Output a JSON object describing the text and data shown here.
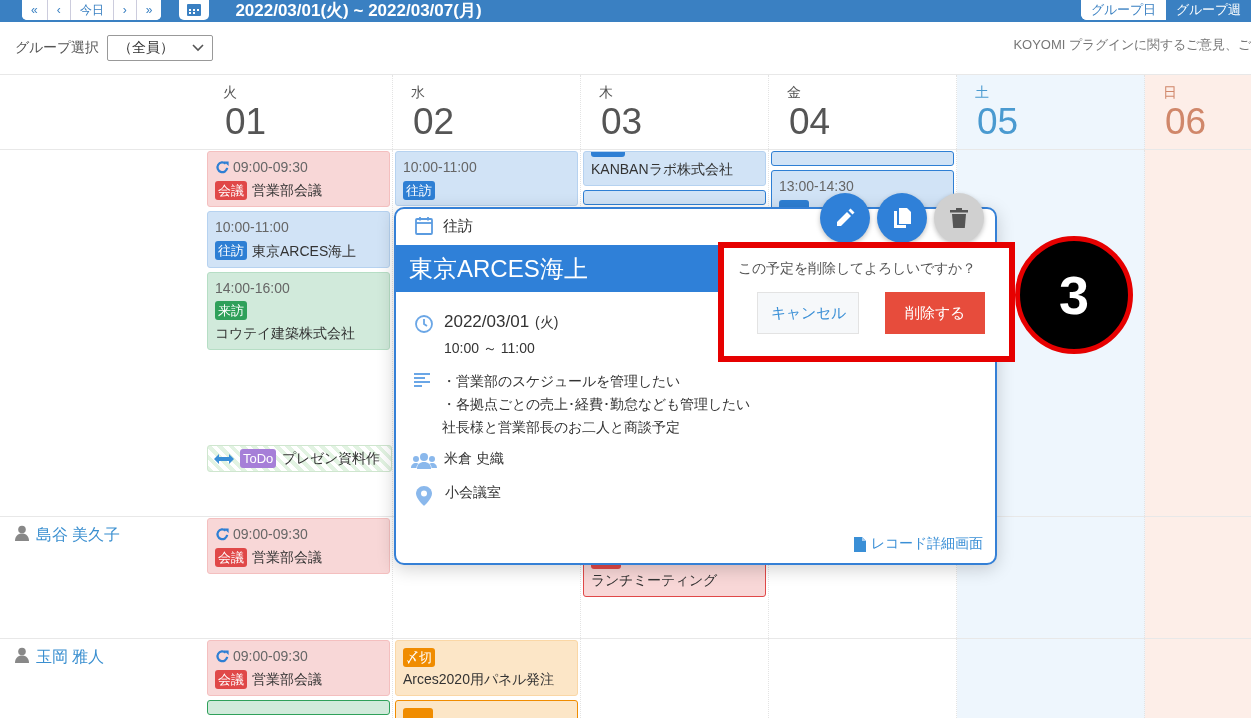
{
  "header": {
    "nav_buttons": [
      "«",
      "‹",
      "今日",
      "›",
      "»"
    ],
    "title": "2022/03/01(火) ~ 2022/03/07(月)",
    "view_buttons": [
      {
        "label": "グループ日",
        "selected": false
      },
      {
        "label": "グループ週",
        "selected": true
      }
    ]
  },
  "toolbar": {
    "group_label": "グループ選択",
    "group_select": "（全員）",
    "notice": "KOYOMI プラグインに関するご意見、ご"
  },
  "days": [
    {
      "weekday": "火",
      "date": "01",
      "kind": "weekday"
    },
    {
      "weekday": "水",
      "date": "02",
      "kind": "weekday"
    },
    {
      "weekday": "木",
      "date": "03",
      "kind": "weekday"
    },
    {
      "weekday": "金",
      "date": "04",
      "kind": "weekday"
    },
    {
      "weekday": "土",
      "date": "05",
      "kind": "saturday"
    },
    {
      "weekday": "日",
      "date": "06",
      "kind": "sunday"
    }
  ],
  "rows": [
    {
      "cells": [
        [
          {
            "kind": "timed",
            "repeat": true,
            "time": "09:00-09:30",
            "tag": "会議",
            "title": "営業部会議",
            "color": "#e04848"
          },
          {
            "kind": "timed",
            "repeat": false,
            "time": "10:00-11:00",
            "tag": "往訪",
            "title": "東京ARCES海上",
            "color": "#2e7fd4"
          },
          {
            "kind": "timed",
            "repeat": false,
            "time": "14:00-16:00",
            "tag": "来訪",
            "title": "コウテイ建築株式会社",
            "color": "#2fa05a"
          },
          {
            "kind": "todo",
            "tag": "ToDo",
            "title": "プレゼン資料作",
            "color": "#a67fd8"
          }
        ],
        [
          {
            "kind": "timed",
            "repeat": false,
            "time": "10:00-11:00",
            "tag": "往訪",
            "color": "#2e7fd4"
          }
        ],
        [
          {
            "kind": "clipped",
            "title": "KANBANラボ株式会社",
            "color": "#2e7fd4"
          },
          {
            "kind": "fragment",
            "color": "#2e7fd4"
          }
        ],
        [
          {
            "kind": "fragment",
            "color": "#2e7fd4"
          },
          {
            "kind": "timed",
            "repeat": false,
            "time": "13:00-14:30",
            "color": "#2e7fd4"
          }
        ],
        [],
        []
      ]
    },
    {
      "user": "島谷 美久子",
      "cells": [
        [
          {
            "kind": "timed",
            "repeat": true,
            "time": "09:00-09:30",
            "tag": "会議",
            "title": "営業部会議",
            "color": "#e04848"
          }
        ],
        [],
        [
          {
            "kind": "tail",
            "title": "ランチミーティング",
            "color": "#e04848"
          }
        ],
        [],
        [],
        []
      ]
    },
    {
      "user": "玉岡 雅人",
      "cells": [
        [
          {
            "kind": "timed",
            "repeat": true,
            "time": "09:00-09:30",
            "tag": "会議",
            "title": "営業部会議",
            "color": "#e04848"
          },
          {
            "kind": "fragment",
            "color": "#2fa05a"
          }
        ],
        [
          {
            "kind": "deadline",
            "tag": "〆切",
            "title": "Arces2020用パネル発注",
            "color": "#f08c00"
          },
          {
            "kind": "deadline",
            "color": "#f08c00"
          }
        ],
        [],
        [],
        [],
        []
      ]
    }
  ],
  "popup": {
    "category": "往訪",
    "title": "東京ARCES海上",
    "date": "2022/03/01",
    "weekday": "(火)",
    "time": "10:00 ～ 11:00",
    "description": [
      "・営業部のスケジュールを管理したい",
      "・各拠点ごとの売上･経費･勤怠なども管理したい",
      "社長様と営業部長のお二人と商談予定"
    ],
    "attendee": "米倉 史織",
    "location": "小会議室",
    "detail_link": "レコード詳細画面",
    "actions": [
      {
        "kind": "edit"
      },
      {
        "kind": "copy"
      },
      {
        "kind": "delete"
      }
    ]
  },
  "confirm": {
    "message": "この予定を削除してよろしいですか？",
    "cancel": "キャンセル",
    "delete": "削除する"
  },
  "annotation": {
    "number": "3"
  }
}
